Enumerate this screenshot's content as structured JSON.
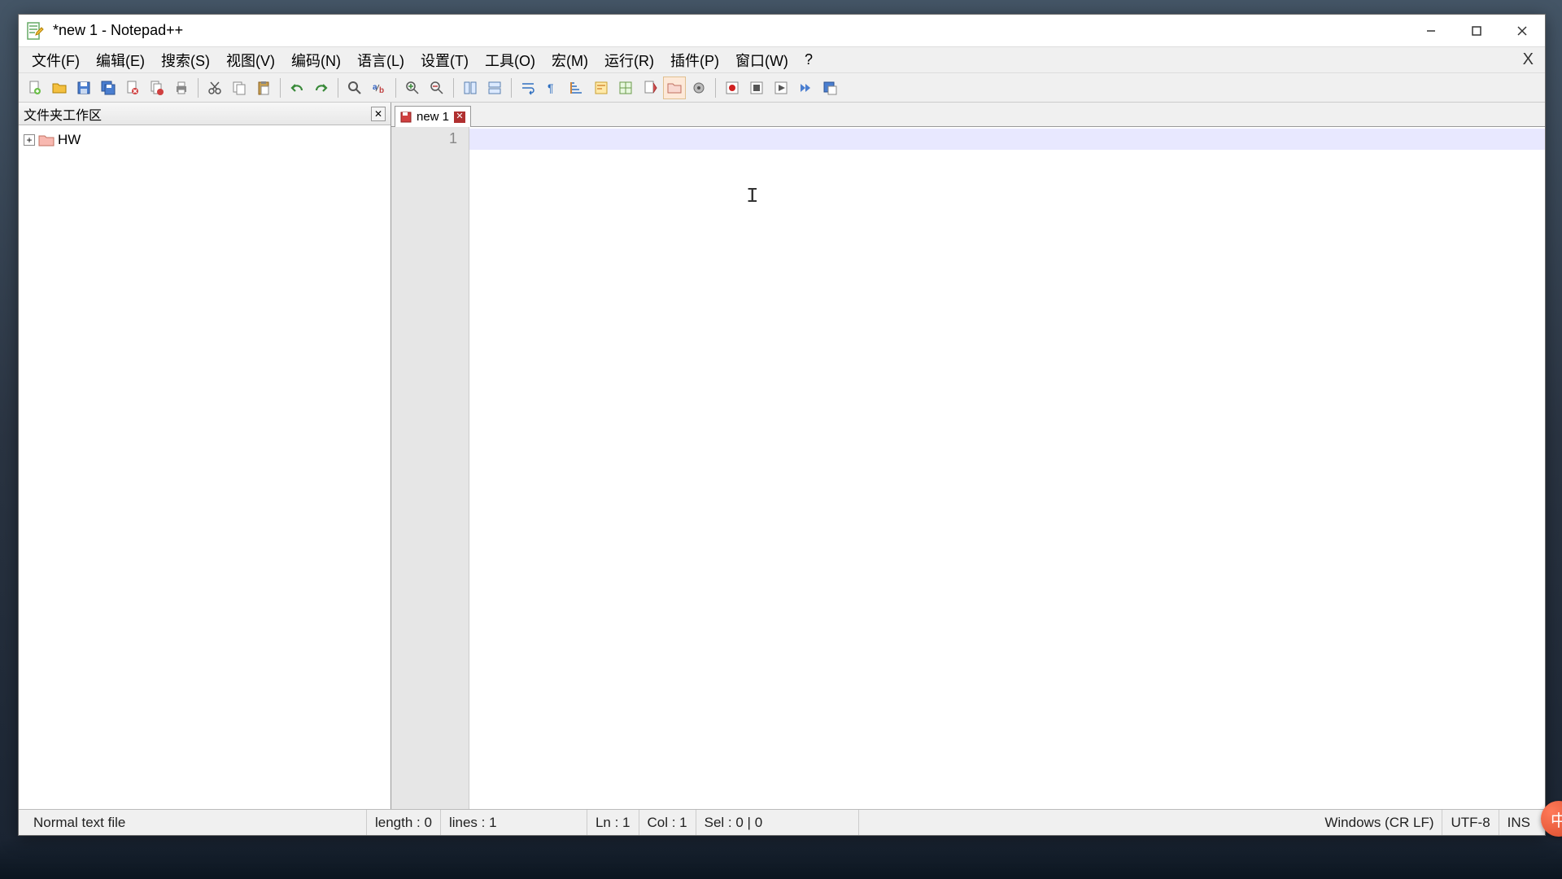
{
  "window": {
    "title": "*new 1 - Notepad++"
  },
  "menus": [
    "文件(F)",
    "编辑(E)",
    "搜索(S)",
    "视图(V)",
    "编码(N)",
    "语言(L)",
    "设置(T)",
    "工具(O)",
    "宏(M)",
    "运行(R)",
    "插件(P)",
    "窗口(W)",
    "?"
  ],
  "folder_panel": {
    "title": "文件夹工作区",
    "root": {
      "label": "HW"
    }
  },
  "tab": {
    "label": "new 1"
  },
  "editor": {
    "line_number": "1"
  },
  "status": {
    "filetype": "Normal text file",
    "length": "length : 0",
    "lines": "lines : 1",
    "ln": "Ln : 1",
    "col": "Col : 1",
    "sel": "Sel : 0 | 0",
    "eol": "Windows (CR LF)",
    "encoding": "UTF-8",
    "ins": "INS"
  },
  "ime": "中"
}
